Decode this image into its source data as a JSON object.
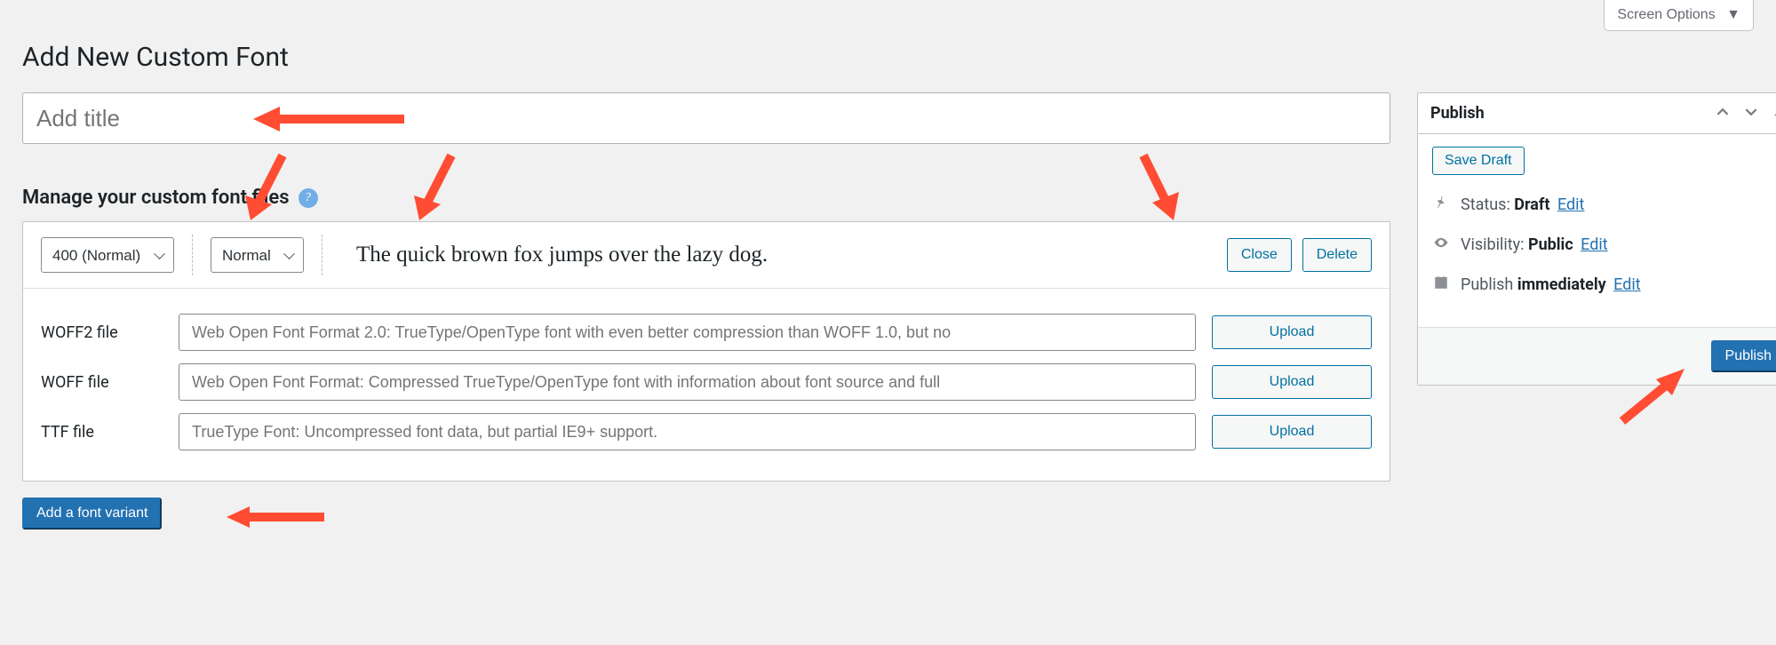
{
  "screen_options_label": "Screen Options",
  "page_title": "Add New Custom Font",
  "title_placeholder": "Add title",
  "manage_heading": "Manage your custom font files",
  "variant": {
    "weight_options": [
      "400 (Normal)"
    ],
    "style_options": [
      "Normal"
    ],
    "preview": "The quick brown fox jumps over the lazy dog.",
    "close_label": "Close",
    "delete_label": "Delete"
  },
  "rows": [
    {
      "label": "WOFF2 file",
      "placeholder": "Web Open Font Format 2.0: TrueType/OpenType font with even better compression than WOFF 1.0, but no",
      "upload": "Upload"
    },
    {
      "label": "WOFF file",
      "placeholder": "Web Open Font Format: Compressed TrueType/OpenType font with information about font source and full",
      "upload": "Upload"
    },
    {
      "label": "TTF file",
      "placeholder": "TrueType Font: Uncompressed font data, but partial IE9+ support.",
      "upload": "Upload"
    }
  ],
  "add_variant_label": "Add a font variant",
  "publish_box": {
    "title": "Publish",
    "save_draft": "Save Draft",
    "status_label": "Status: ",
    "status_value": "Draft",
    "status_edit": "Edit",
    "visibility_label": "Visibility: ",
    "visibility_value": "Public",
    "visibility_edit": "Edit",
    "publish_time_label": "Publish ",
    "publish_time_value": "immediately",
    "publish_time_edit": "Edit",
    "publish_button": "Publish"
  }
}
